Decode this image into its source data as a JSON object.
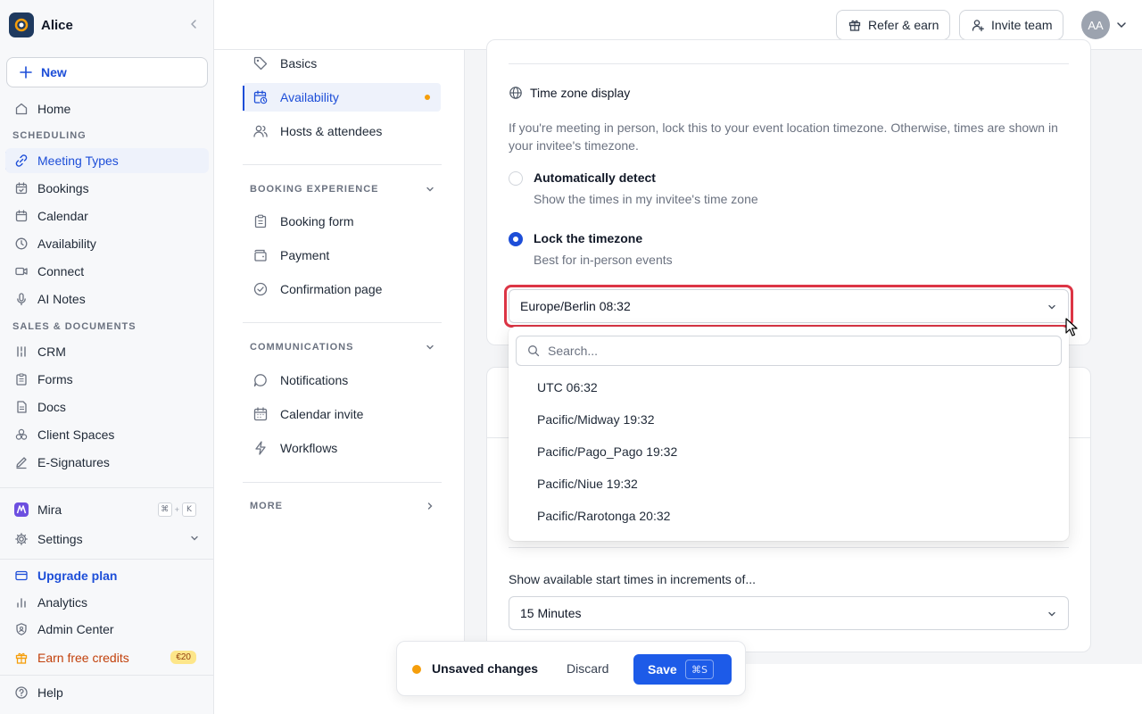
{
  "workspace": {
    "name": "Alice"
  },
  "sidebar": {
    "new_label": "New",
    "home": "Home",
    "section_scheduling": "SCHEDULING",
    "scheduling_items": [
      {
        "label": "Meeting Types",
        "icon": "link-icon",
        "active": true
      },
      {
        "label": "Bookings",
        "icon": "calendar-check-icon"
      },
      {
        "label": "Calendar",
        "icon": "calendar-icon"
      },
      {
        "label": "Availability",
        "icon": "clock-icon"
      },
      {
        "label": "Connect",
        "icon": "video-icon"
      },
      {
        "label": "AI Notes",
        "icon": "microphone-icon"
      }
    ],
    "section_sales": "SALES & DOCUMENTS",
    "sales_items": [
      {
        "label": "CRM",
        "icon": "crm-icon"
      },
      {
        "label": "Forms",
        "icon": "clipboard-icon"
      },
      {
        "label": "Docs",
        "icon": "document-icon"
      },
      {
        "label": "Client Spaces",
        "icon": "spaces-icon"
      },
      {
        "label": "E-Signatures",
        "icon": "pen-icon"
      }
    ],
    "mira": {
      "label": "Mira",
      "shortcut": [
        "⌘",
        "+",
        "K"
      ]
    },
    "settings": "Settings",
    "upgrade": "Upgrade plan",
    "analytics": "Analytics",
    "admin": "Admin Center",
    "earn": {
      "label": "Earn free credits",
      "badge": "€20"
    },
    "help": "Help"
  },
  "topbar": {
    "refer": "Refer & earn",
    "invite": "Invite team",
    "avatar_initials": "AA"
  },
  "midnav": {
    "items_top": [
      {
        "label": "Basics",
        "icon": "tag-icon"
      },
      {
        "label": "Availability",
        "icon": "calendar-clock-icon",
        "active": true,
        "unsaved_dot": true
      },
      {
        "label": "Hosts & attendees",
        "icon": "users-icon"
      }
    ],
    "section_booking": "BOOKING EXPERIENCE",
    "booking_items": [
      {
        "label": "Booking form",
        "icon": "clipboard-icon"
      },
      {
        "label": "Payment",
        "icon": "wallet-icon"
      },
      {
        "label": "Confirmation page",
        "icon": "check-circle-icon"
      }
    ],
    "section_comms": "COMMUNICATIONS",
    "comms_items": [
      {
        "label": "Notifications",
        "icon": "chat-bubble-icon"
      },
      {
        "label": "Calendar invite",
        "icon": "calendar-icon"
      },
      {
        "label": "Workflows",
        "icon": "lightning-icon"
      }
    ],
    "section_more": "MORE"
  },
  "timezone": {
    "heading": "Time zone display",
    "description": "If you're meeting in person, lock this to your event location timezone. Otherwise, times are shown in your invitee's timezone.",
    "options": [
      {
        "title": "Automatically detect",
        "subtitle": "Show the times in my invitee's time zone",
        "checked": false
      },
      {
        "title": "Lock the timezone",
        "subtitle": "Best for in-person events",
        "checked": true
      }
    ],
    "selected": "Europe/Berlin 08:32",
    "search_placeholder": "Search...",
    "dropdown_options": [
      "UTC 06:32",
      "Pacific/Midway 19:32",
      "Pacific/Pago_Pago 19:32",
      "Pacific/Niue 19:32",
      "Pacific/Rarotonga 20:32"
    ]
  },
  "increments": {
    "label": "Show available start times in increments of...",
    "value": "15 Minutes"
  },
  "unsaved_bar": {
    "text": "Unsaved changes",
    "discard": "Discard",
    "save": "Save",
    "save_shortcut": "⌘S"
  },
  "colors": {
    "accent": "#1d4ed8",
    "save_button": "#1d5be8",
    "unsaved_dot": "#f59e0b",
    "focus_ring": "#dc3545"
  }
}
